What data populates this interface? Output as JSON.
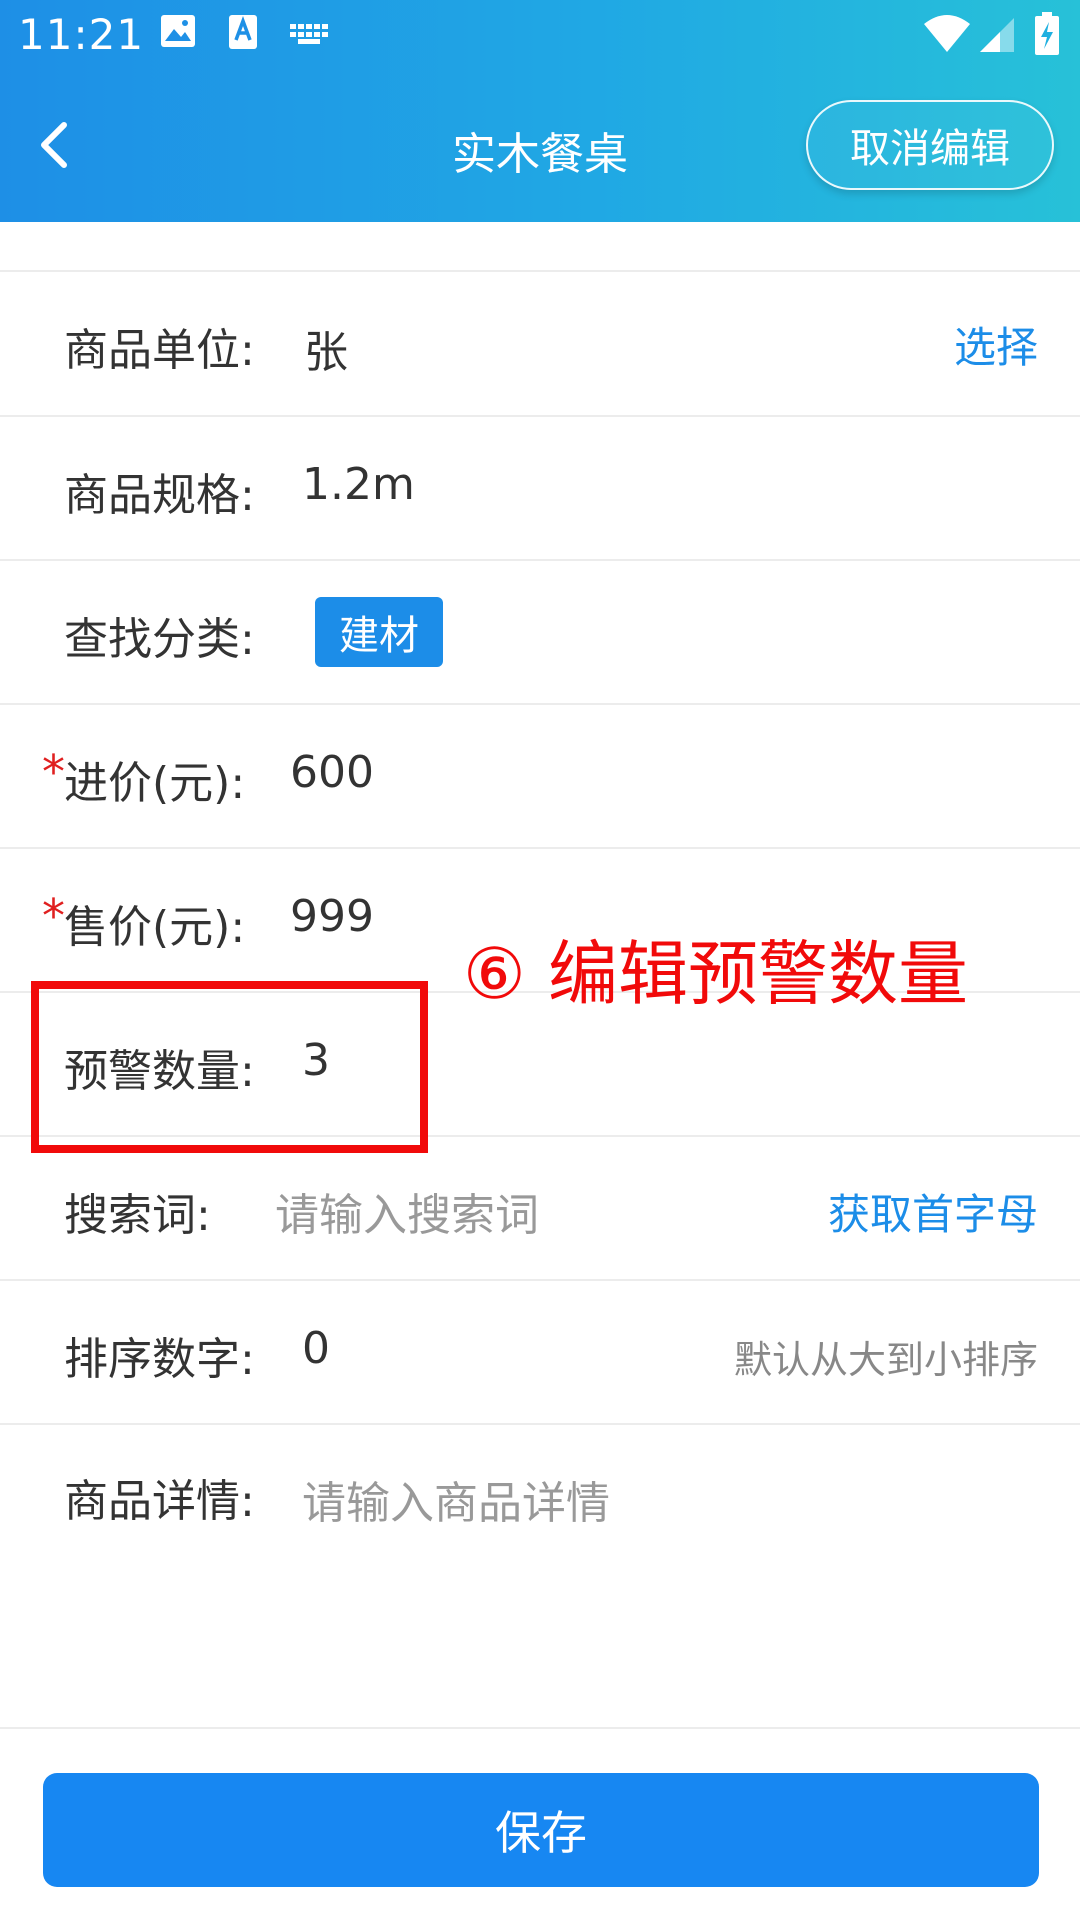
{
  "status_bar": {
    "time": "11:21",
    "icons": [
      "image-icon",
      "text-a-icon",
      "keyboard-icon",
      "wifi-icon",
      "signal-icon",
      "battery-charging-icon"
    ]
  },
  "nav": {
    "back_icon": "chevron-left-icon",
    "title": "实木餐桌",
    "cancel_label": "取消编辑"
  },
  "form": {
    "unit": {
      "label": "商品单位:",
      "value": "张",
      "action": "选择"
    },
    "spec": {
      "label": "商品规格:",
      "value": "1.2m"
    },
    "category": {
      "label": "查找分类:",
      "tag": "建材"
    },
    "purchase_price": {
      "required_mark": "*",
      "label": "进价(元):",
      "value": "600"
    },
    "sale_price": {
      "required_mark": "*",
      "label": "售价(元):",
      "value": "999"
    },
    "alert_qty": {
      "label": "预警数量:",
      "value": "3"
    },
    "search_term": {
      "label": "搜索词:",
      "placeholder": "请输入搜索词",
      "action": "获取首字母"
    },
    "sort": {
      "label": "排序数字:",
      "value": "0",
      "hint": "默认从大到小排序"
    },
    "detail": {
      "label": "商品详情:",
      "placeholder": "请输入商品详情"
    }
  },
  "annotation": {
    "text": "⑥ 编辑预警数量"
  },
  "save_label": "保存",
  "colors": {
    "header_start": "#1e8fe6",
    "header_end": "#27c1d8",
    "accent": "#1c8de8",
    "required": "#e02020",
    "annotation": "#f10a0a"
  }
}
